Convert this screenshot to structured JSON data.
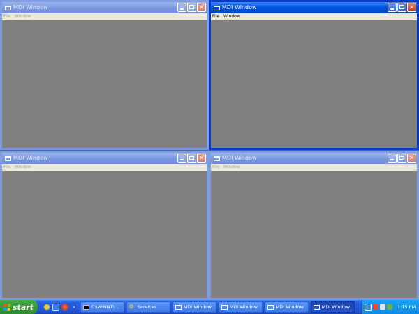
{
  "windows": [
    {
      "title": "MDI Window",
      "active": false,
      "menu": [
        "File",
        "Window"
      ]
    },
    {
      "title": "MDI Window",
      "active": true,
      "menu": [
        "File",
        "Window"
      ]
    },
    {
      "title": "MDI Window",
      "active": false,
      "menu": [
        "File",
        "Window"
      ]
    },
    {
      "title": "MDI Window",
      "active": false,
      "menu": [
        "File",
        "Window"
      ]
    }
  ],
  "colors": {
    "desktop": "#3a6ea5",
    "client_area": "#7f7f7f",
    "active_title": "#0054e3",
    "inactive_title": "#7b9ae0",
    "taskbar": "#245edb",
    "start_button": "#389a3a"
  },
  "taskbar": {
    "start_label": "start",
    "quick_launch": [
      "ie-icon",
      "desktop-icon",
      "media-icon"
    ],
    "tasks": [
      {
        "label": "C:\\WINNT\\...",
        "icon": "cmd-icon",
        "active": false
      },
      {
        "label": "Services",
        "icon": "services-icon",
        "active": false
      },
      {
        "label": "MDI Window",
        "icon": "window-icon",
        "active": false
      },
      {
        "label": "MDI Window",
        "icon": "window-icon",
        "active": false
      },
      {
        "label": "MDI Window",
        "icon": "window-icon",
        "active": false
      },
      {
        "label": "MDI Window",
        "icon": "window-icon",
        "active": true
      }
    ],
    "clock": "1:15 PM"
  }
}
